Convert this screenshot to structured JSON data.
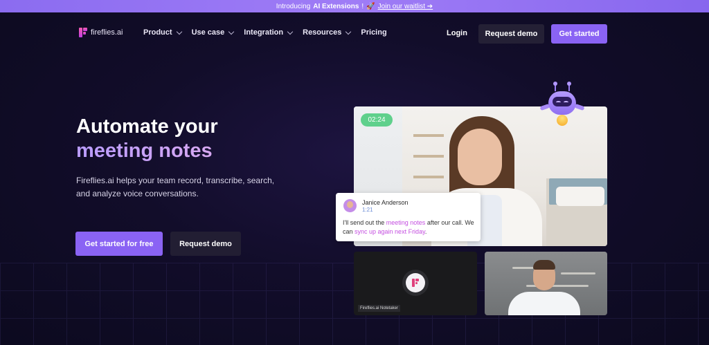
{
  "banner": {
    "prefix": "Introducing",
    "highlight": "AI Extensions",
    "exclaim": "!",
    "emoji": "🚀",
    "link": "Join our waitlist ➔"
  },
  "nav": {
    "logo": "fireflies.ai",
    "items": [
      {
        "label": "Product",
        "dropdown": true
      },
      {
        "label": "Use case",
        "dropdown": true
      },
      {
        "label": "Integration",
        "dropdown": true
      },
      {
        "label": "Resources",
        "dropdown": true
      },
      {
        "label": "Pricing",
        "dropdown": false
      }
    ],
    "login": "Login",
    "request_demo": "Request demo",
    "get_started": "Get started"
  },
  "hero": {
    "title_line1": "Automate your",
    "title_line2": "meeting notes",
    "subtitle": "Fireflies.ai helps your team record, transcribe, search, and analyze voice conversations.",
    "cta_primary": "Get started for free",
    "cta_secondary": "Request demo"
  },
  "video": {
    "timer": "02:24",
    "notetaker_label": "Fireflies.ai Notetaker"
  },
  "caption": {
    "name": "Janice Anderson",
    "time": "1:21",
    "text_a": "I'll send out the ",
    "text_hl1": "meeting notes",
    "text_b": " after our call. We can ",
    "text_hl2": "sync up again next Friday",
    "text_c": "."
  },
  "colors": {
    "accent": "#8a63f4",
    "highlight": "#c44ee0",
    "timer_green": "#5fd08c"
  }
}
